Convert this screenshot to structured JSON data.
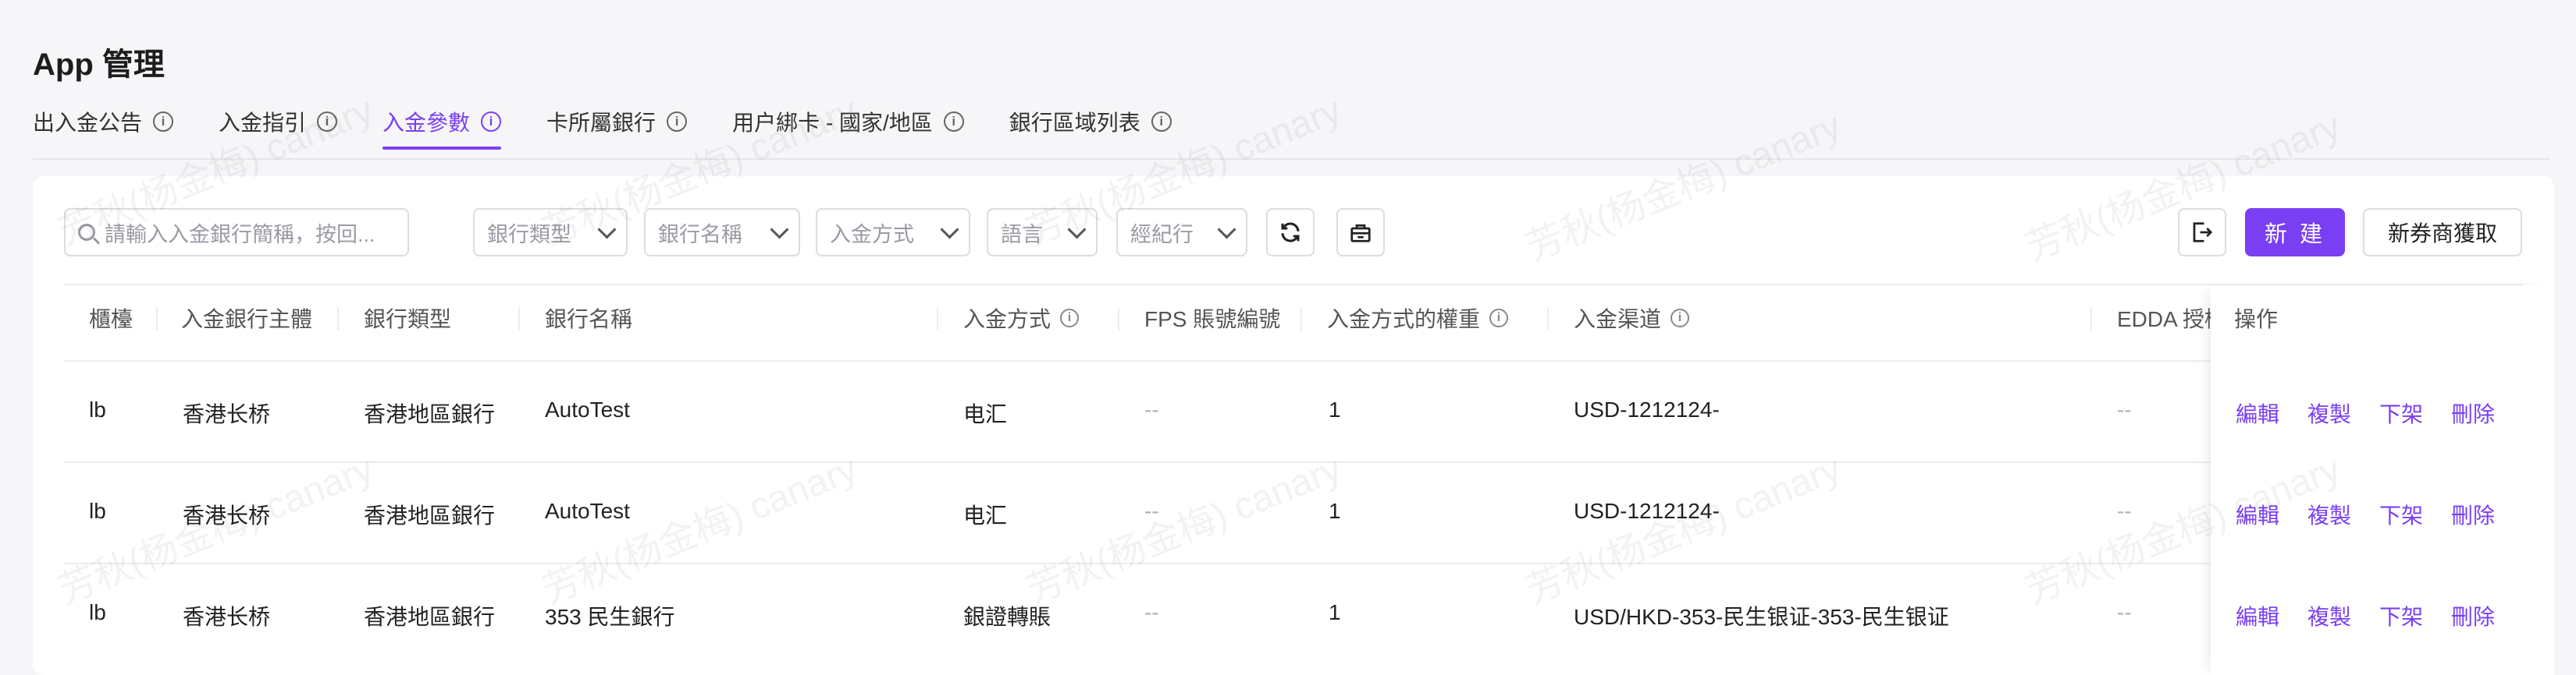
{
  "page": {
    "title": "App 管理"
  },
  "tabs": [
    {
      "label": "出入金公告",
      "active": false
    },
    {
      "label": "入金指引",
      "active": false
    },
    {
      "label": "入金參數",
      "active": true
    },
    {
      "label": "卡所屬銀行",
      "active": false
    },
    {
      "label": "用户綁卡 - 國家/地區",
      "active": false
    },
    {
      "label": "銀行區域列表",
      "active": false
    }
  ],
  "filters": {
    "search_placeholder": "請輸入入金銀行簡稱，按回...",
    "bank_type": "銀行類型",
    "bank_name": "銀行名稱",
    "deposit_method": "入金方式",
    "language": "語言",
    "broker": "經紀行"
  },
  "toolbar": {
    "refresh_icon": "refresh-icon",
    "basket_icon": "basket-icon",
    "export_icon": "export-icon",
    "new_label": "新 建",
    "fetch_label": "新券商獲取"
  },
  "table": {
    "headers": {
      "counter": "櫃檯",
      "entity": "入金銀行主體",
      "bank_type": "銀行類型",
      "bank_name": "銀行名稱",
      "method": "入金方式",
      "fps": "FPS 賬號編號",
      "weight": "入金方式的權重",
      "channel": "入金渠道",
      "edda": "EDDA 授權",
      "ops": "操作"
    },
    "rows": [
      {
        "counter": "lb",
        "entity": "香港长桥",
        "bank_type": "香港地區銀行",
        "bank_name": "AutoTest",
        "method": "电汇",
        "fps": "--",
        "weight": "1",
        "channel": "USD-1212124-",
        "edda": "--"
      },
      {
        "counter": "lb",
        "entity": "香港长桥",
        "bank_type": "香港地區銀行",
        "bank_name": "AutoTest",
        "method": "电汇",
        "fps": "--",
        "weight": "1",
        "channel": "USD-1212124-",
        "edda": "--"
      },
      {
        "counter": "lb",
        "entity": "香港长桥",
        "bank_type": "香港地區銀行",
        "bank_name": "353 民生銀行",
        "method": "銀證轉賬",
        "fps": "--",
        "weight": "1",
        "channel": "USD/HKD-353-民生银证-353-民生银证",
        "edda": "--"
      }
    ],
    "actions": {
      "edit": "編輯",
      "copy": "複製",
      "unlist": "下架",
      "delete": "刪除"
    }
  },
  "watermark": "芳秋(杨金梅) canary",
  "colors": {
    "accent": "#7a3ff2",
    "background": "#f6f6f8",
    "card": "#ffffff"
  }
}
